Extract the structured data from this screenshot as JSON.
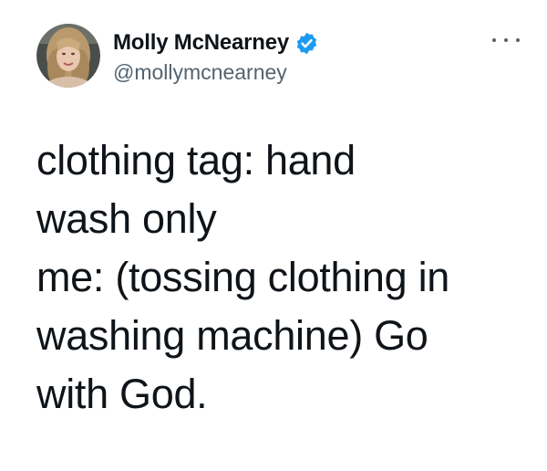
{
  "author": {
    "display_name": "Molly McNearney",
    "handle": "@mollymcnearney",
    "verified": true,
    "verified_icon": "verified-badge-icon",
    "verified_color": "#1d9bf0"
  },
  "menu": {
    "icon": "more-options-icon"
  },
  "tweet": {
    "lines": [
      "clothing tag: hand",
      "wash only",
      "me: (tossing clothing in",
      "washing machine) Go",
      "with God."
    ]
  },
  "colors": {
    "text": "#0f1419",
    "secondary": "#536471",
    "background": "#ffffff"
  }
}
